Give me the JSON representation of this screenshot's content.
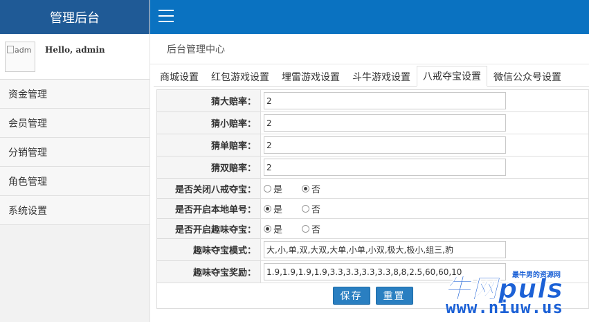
{
  "sidebar": {
    "brand": "管理后台",
    "avatar_alt": "adm",
    "greeting": "Hello, admin",
    "items": [
      {
        "label": "资金管理"
      },
      {
        "label": "会员管理"
      },
      {
        "label": "分销管理"
      },
      {
        "label": "角色管理"
      },
      {
        "label": "系统设置"
      }
    ]
  },
  "header": {
    "breadcrumb": "后台管理中心"
  },
  "tabs": [
    {
      "label": "商城设置",
      "active": false
    },
    {
      "label": "红包游戏设置",
      "active": false
    },
    {
      "label": "埋雷游戏设置",
      "active": false
    },
    {
      "label": "斗牛游戏设置",
      "active": false
    },
    {
      "label": "八戒夺宝设置",
      "active": true
    },
    {
      "label": "微信公众号设置",
      "active": false
    }
  ],
  "form": {
    "big_odds": {
      "label": "猜大赔率：",
      "value": "2"
    },
    "small_odds": {
      "label": "猜小赔率：",
      "value": "2"
    },
    "odd_odds": {
      "label": "猜单赔率：",
      "value": "2"
    },
    "even_odds": {
      "label": "猜双赔率：",
      "value": "2"
    },
    "close_bajie": {
      "label": "是否关闭八戒夺宝：",
      "yes": "是",
      "no": "否",
      "selected": "否"
    },
    "local_single": {
      "label": "是否开启本地单号：",
      "yes": "是",
      "no": "否",
      "selected": "是"
    },
    "fun_treasure": {
      "label": "是否开启趣味夺宝：",
      "yes": "是",
      "no": "否",
      "selected": "是"
    },
    "fun_mode": {
      "label": "趣味夺宝模式：",
      "value": "大,小,单,双,大双,大单,小单,小双,极大,极小,组三,豹"
    },
    "fun_reward": {
      "label": "趣味夺宝奖励：",
      "value": "1.9,1.9,1.9,1.9,3.3,3.3,3.3,3.3,8,8,2.5,60,60,10"
    },
    "save_label": "保存",
    "reset_label": "重置"
  },
  "watermark": {
    "brand": "牛网puls",
    "slogan": "最牛男的资源网",
    "url": "www.niuw.us"
  },
  "colors": {
    "brand": "#1f5a96",
    "topbar": "#0a72c1",
    "button": "#2a7fc1"
  }
}
